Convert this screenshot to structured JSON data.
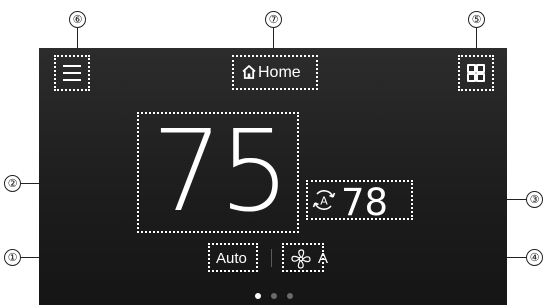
{
  "header": {
    "home_label": "Home",
    "menu_icon": "hamburger-menu-icon",
    "home_icon": "home-icon",
    "apps_icon": "grid-apps-icon"
  },
  "main": {
    "current_temp": "75",
    "auto_icon": "auto-circular-arrow-icon",
    "setpoint_temp": "78"
  },
  "footer": {
    "mode_label": "Auto",
    "fan_icon": "fan-icon",
    "fan_label": "A",
    "page_dots": {
      "count": 3,
      "active_index": 0
    }
  },
  "callouts": {
    "c1": "①",
    "c2": "②",
    "c3": "③",
    "c4": "④",
    "c5": "⑤",
    "c6": "⑥",
    "c7": "⑦"
  },
  "colors": {
    "background_top": "#2c2c2c",
    "background_bottom": "#151515",
    "text": "#ffffff",
    "dot_active": "#ffffff",
    "dot_inactive": "#6a6a6a"
  }
}
